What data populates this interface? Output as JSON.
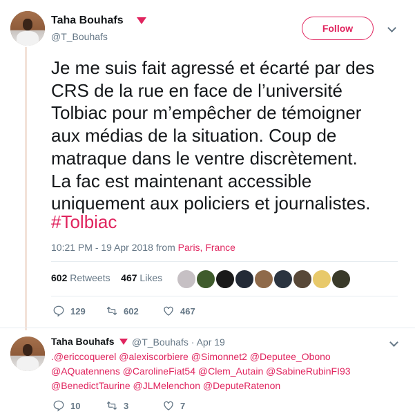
{
  "tweet": {
    "author_name": "Taha Bouhafs",
    "author_handle": "@T_Bouhafs",
    "follow_label": "Follow",
    "text": "Je me suis fait agressé et écarté par des\nCRS de la rue en face de l’université\nTolbiac pour m’empêcher de témoigner\naux médias de la situation. Coup de\nmatraque dans le ventre discrètement.\nLa fac est maintenant accessible\nuniquement aux policiers et journalistes.",
    "hashtag": "#Tolbiac",
    "time": "10:21 PM - 19 Apr 2018 from ",
    "location": "Paris, France",
    "retweets_count": "602",
    "retweets_label": "Retweets",
    "likes_count": "467",
    "likes_label": "Likes",
    "actions": {
      "replies": "129",
      "retweets": "602",
      "likes": "467"
    }
  },
  "liker_avatars": [
    "#c6c0c4",
    "#3f5b2c",
    "#1a1a1a",
    "#232a36",
    "#8f6a4a",
    "#2b3440",
    "#584838",
    "#e8c96a",
    "#3a3a2a"
  ],
  "reply": {
    "author_name": "Taha Bouhafs",
    "author_handle": "@T_Bouhafs · Apr 19",
    "mentions": "@ericcoquerel @alexiscorbiere @Simonnet2 @Deputee_Obono @AQuatennens @CarolineFiat54 @Clem_Autain @SabineRubinFI93 @BenedictTaurine @JLMelenchon @DepteRatenon",
    "mentions_display": ".@ericcoquerel @alexiscorbiere @Simonnet2 @Deputee_Obono\n@AQuatennens @CarolineFiat54 @Clem_Autain @SabineRubinFI93\n@BenedictTaurine @JLMelenchon @DeputeRatenon",
    "actions": {
      "replies": "10",
      "retweets": "3",
      "likes": "7"
    }
  },
  "colors": {
    "accent": "#e0245e",
    "muted": "#657786",
    "text": "#14171a"
  }
}
